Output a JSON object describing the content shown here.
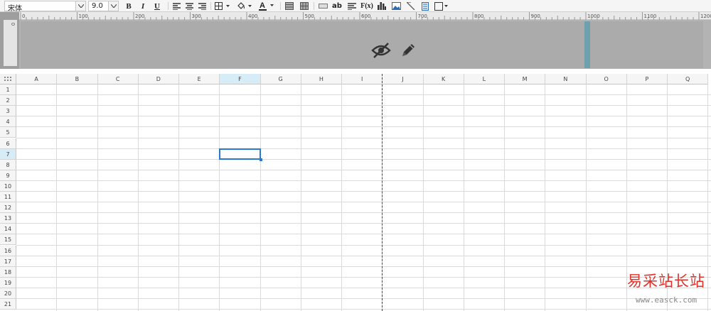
{
  "toolbar": {
    "font_name": "宋体",
    "font_size": "9.0",
    "bold_label": "B",
    "italic_label": "I",
    "underline_label": "U",
    "text_icon_label": "ab",
    "formula_label": "F(x)"
  },
  "ruler": {
    "ticks": [
      "0",
      "100",
      "200",
      "300",
      "400",
      "500",
      "600",
      "700",
      "800",
      "900",
      "1000",
      "1100",
      "1200"
    ],
    "vertical_label": "0"
  },
  "grid": {
    "columns": [
      "A",
      "B",
      "C",
      "D",
      "E",
      "F",
      "G",
      "H",
      "I",
      "J",
      "K",
      "L",
      "M",
      "N",
      "O",
      "P",
      "Q"
    ],
    "rows": [
      "1",
      "2",
      "3",
      "4",
      "5",
      "6",
      "7",
      "8",
      "9",
      "10",
      "11",
      "12",
      "13",
      "14",
      "15",
      "16",
      "17",
      "18",
      "19",
      "20",
      "21"
    ],
    "selected_column": "F",
    "selected_row": "7"
  },
  "watermark": {
    "site_name": "易采站长站",
    "url": "www.easck.com"
  },
  "colors": {
    "accent": "#2a7ad1",
    "band_divider": "#6fa0ad",
    "watermark_red": "#e0312a",
    "selected_header": "#d6ecf7"
  },
  "icons": {
    "band": [
      "eye-slash-icon",
      "pencil-icon"
    ]
  }
}
